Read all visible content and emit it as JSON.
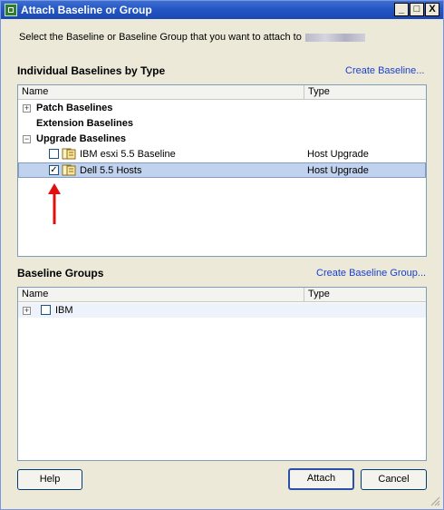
{
  "window": {
    "title": "Attach Baseline or Group",
    "buttons": {
      "minimize": "_",
      "maximize": "□",
      "close": "X"
    }
  },
  "instruction": "Select the Baseline or Baseline Group that you want to attach to",
  "baselines": {
    "label": "Individual Baselines by Type",
    "create_link": "Create Baseline...",
    "columns": [
      "Name",
      "Type"
    ],
    "rows": [
      {
        "label": "Patch Baselines",
        "type": ""
      },
      {
        "label": "Extension Baselines",
        "type": ""
      },
      {
        "label": "Upgrade Baselines",
        "type": ""
      },
      {
        "label": "IBM esxi 5.5 Baseline",
        "type": "Host Upgrade",
        "checked": false
      },
      {
        "label": "Dell 5.5 Hosts",
        "type": "Host Upgrade",
        "checked": true
      }
    ]
  },
  "groups": {
    "label": "Baseline Groups",
    "create_link": "Create Baseline Group...",
    "columns": [
      "Name",
      "Type"
    ],
    "rows": [
      {
        "label": "IBM",
        "type": "",
        "checked": false
      }
    ]
  },
  "footer": {
    "help": "Help",
    "attach": "Attach",
    "cancel": "Cancel"
  },
  "colors": {
    "accent": "#1a3fd0",
    "selection": "#c1d2ee",
    "arrow": "#e01010"
  }
}
